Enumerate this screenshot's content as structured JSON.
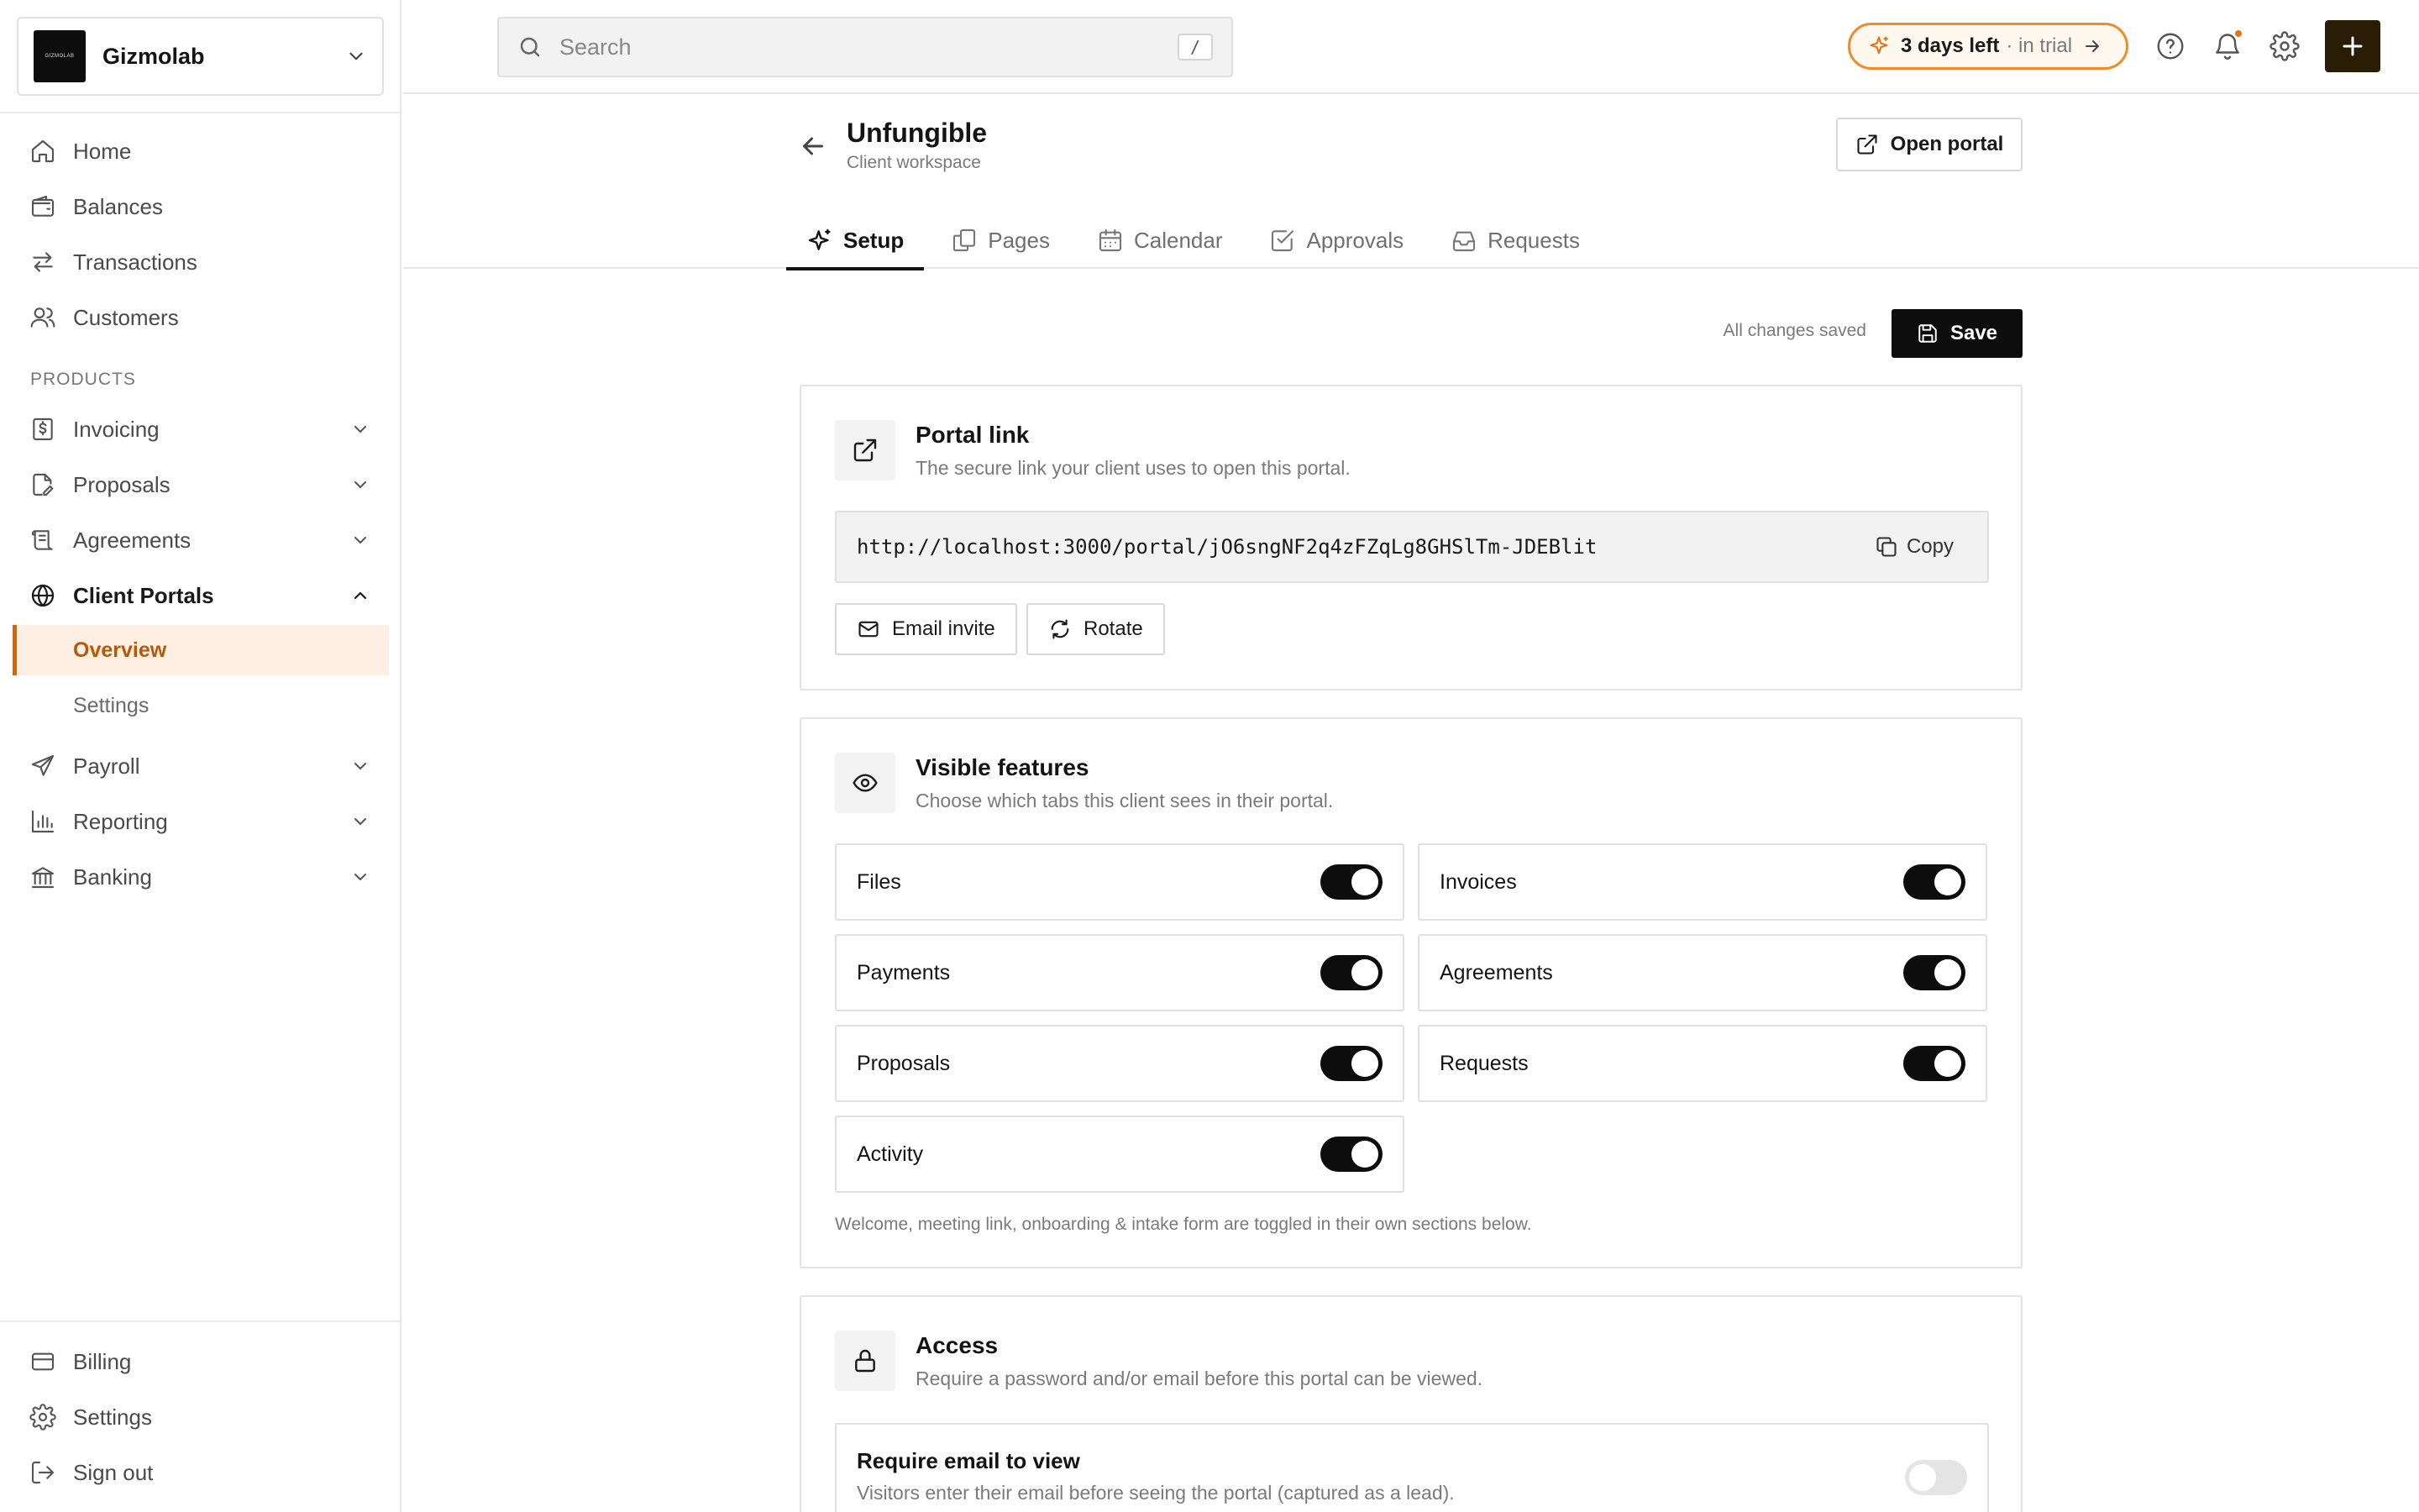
{
  "sidebar": {
    "org_name": "Gizmolab",
    "logo_text": "GIZMOLAB",
    "nav": [
      {
        "label": "Home",
        "icon": "home-icon"
      },
      {
        "label": "Balances",
        "icon": "wallet-icon"
      },
      {
        "label": "Transactions",
        "icon": "arrows-swap-icon"
      },
      {
        "label": "Customers",
        "icon": "users-icon"
      }
    ],
    "section_label": "PRODUCTS",
    "products": [
      {
        "label": "Invoicing",
        "icon": "dollar-doc-icon",
        "expanded": false
      },
      {
        "label": "Proposals",
        "icon": "doc-pen-icon",
        "expanded": false
      },
      {
        "label": "Agreements",
        "icon": "scroll-icon",
        "expanded": false
      },
      {
        "label": "Client Portals",
        "icon": "globe-icon",
        "expanded": true
      },
      {
        "label": "Payroll",
        "icon": "send-icon",
        "expanded": false
      },
      {
        "label": "Reporting",
        "icon": "bar-chart-icon",
        "expanded": false
      },
      {
        "label": "Banking",
        "icon": "bank-icon",
        "expanded": false
      }
    ],
    "portal_sub": [
      {
        "label": "Overview",
        "active": true
      },
      {
        "label": "Settings",
        "active": false
      }
    ],
    "footer": [
      {
        "label": "Billing",
        "icon": "card-icon"
      },
      {
        "label": "Settings",
        "icon": "gear-icon"
      },
      {
        "label": "Sign out",
        "icon": "logout-icon"
      }
    ]
  },
  "topbar": {
    "search_placeholder": "Search",
    "search_shortcut": "/",
    "trial_days": "3 days left",
    "trial_suffix": "· in trial"
  },
  "page": {
    "title": "Unfungible",
    "subtitle": "Client workspace",
    "open_portal": "Open portal",
    "tabs": [
      {
        "label": "Setup",
        "icon": "sparkle-icon",
        "active": true
      },
      {
        "label": "Pages",
        "icon": "pages-icon",
        "active": false
      },
      {
        "label": "Calendar",
        "icon": "calendar-icon",
        "active": false
      },
      {
        "label": "Approvals",
        "icon": "checkbox-icon",
        "active": false
      },
      {
        "label": "Requests",
        "icon": "inbox-icon",
        "active": false
      }
    ],
    "saved_status": "All changes saved",
    "save_label": "Save"
  },
  "portal_link": {
    "title": "Portal link",
    "subtitle": "The secure link your client uses to open this portal.",
    "url": "http://localhost:3000/portal/jO6sngNF2q4zFZqLg8GHSlTm-JDEBlit",
    "copy_label": "Copy",
    "email_invite": "Email invite",
    "rotate": "Rotate"
  },
  "visible_features": {
    "title": "Visible features",
    "subtitle": "Choose which tabs this client sees in their portal.",
    "items": [
      {
        "label": "Files",
        "enabled": true
      },
      {
        "label": "Invoices",
        "enabled": true
      },
      {
        "label": "Payments",
        "enabled": true
      },
      {
        "label": "Agreements",
        "enabled": true
      },
      {
        "label": "Proposals",
        "enabled": true
      },
      {
        "label": "Requests",
        "enabled": true
      },
      {
        "label": "Activity",
        "enabled": true
      }
    ],
    "note": "Welcome, meeting link, onboarding & intake form are toggled in their own sections below."
  },
  "access": {
    "title": "Access",
    "subtitle": "Require a password and/or email before this portal can be viewed.",
    "row_title": "Require email to view",
    "row_desc": "Visitors enter their email before seeing the portal (captured as a lead).",
    "row_enabled": false
  },
  "colors": {
    "accent": "#d9630b",
    "active_bg": "#fdf0e3",
    "primary": "#0d0d0d",
    "plus_button": "#2a1d06"
  }
}
